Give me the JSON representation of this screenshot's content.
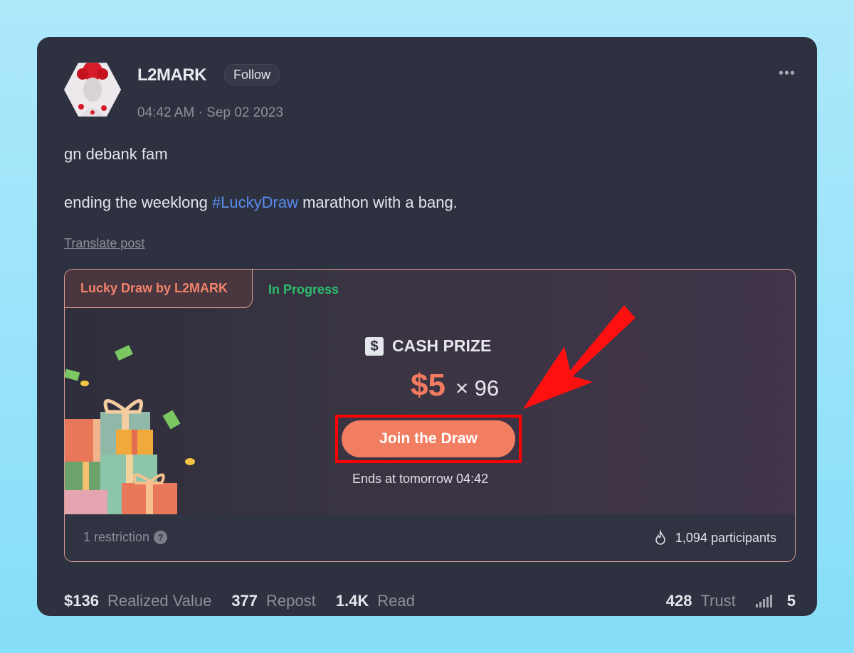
{
  "post": {
    "author": "L2MARK",
    "follow_label": "Follow",
    "timestamp": "04:42 AM · Sep 02 2023",
    "more_label": "•••",
    "line1": "gn debank fam",
    "line2_before": "ending the weeklong ",
    "hashtag": "#LuckyDraw",
    "line2_after": " marathon with a bang.",
    "translate_label": "Translate post"
  },
  "draw": {
    "tab_label": "Lucky Draw by L2MARK",
    "status": "In Progress",
    "prize_icon": "$",
    "prize_label": "CASH PRIZE",
    "amount": "$5",
    "multiplier": "× 96",
    "join_label": "Join the Draw",
    "ends_text": "Ends at tomorrow 04:42",
    "restriction_text": "1 restriction",
    "help_icon": "?",
    "participants_text": "1,094 participants",
    "accent_color": "#f27e62",
    "status_color": "#2bbf6d"
  },
  "stats": {
    "realized_value": "$136",
    "realized_label": "Realized Value",
    "repost": "377",
    "repost_label": "Repost",
    "read": "1.4K",
    "read_label": "Read",
    "trust": "428",
    "trust_label": "Trust",
    "signal": "5"
  },
  "icons": {
    "more": "more-dots-icon",
    "dollar": "dollar-icon",
    "help": "help-icon",
    "participants": "fire-icon",
    "signal": "signal-bars-icon",
    "annotation": "red-arrow-annotation"
  }
}
